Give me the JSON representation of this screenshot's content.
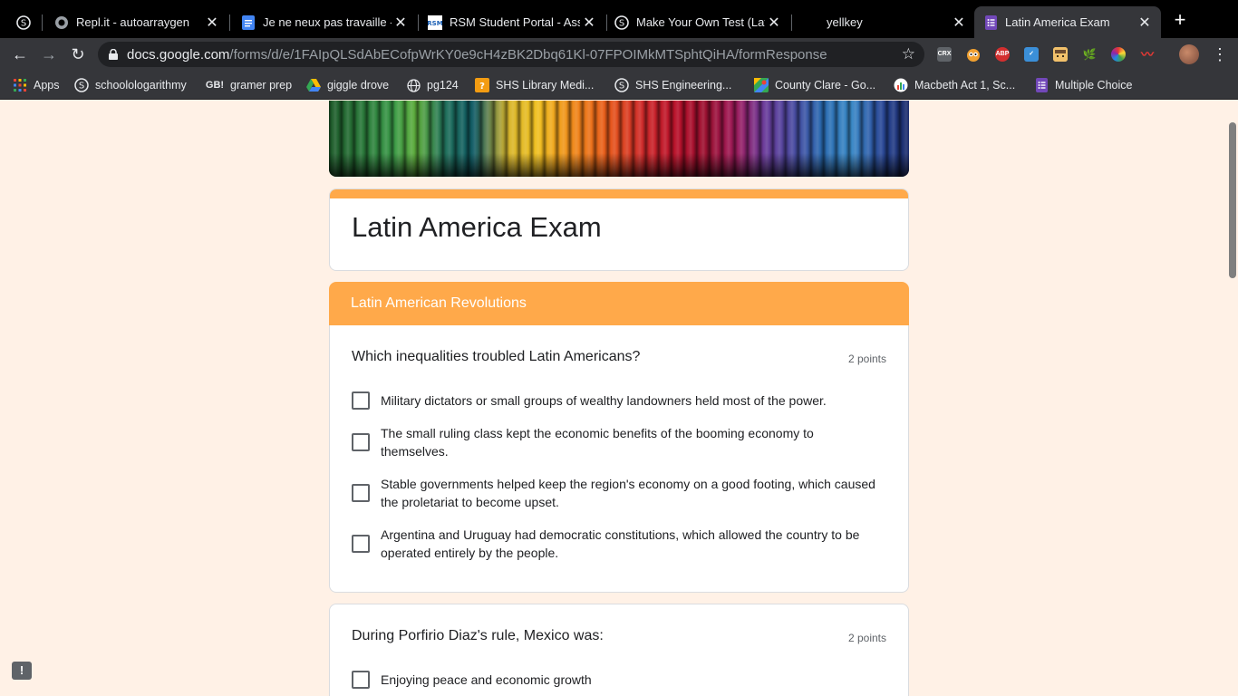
{
  "tabs": [
    {
      "label": "",
      "icon": "replit-icon"
    },
    {
      "label": "Repl.it - autoarraygen",
      "icon": "replit-icon"
    },
    {
      "label": "Je ne neux pas travaille -",
      "icon": "google-docs-icon"
    },
    {
      "label": "RSM Student Portal - Ass",
      "icon": "rsm-icon"
    },
    {
      "label": "Make Your Own Test (Lat",
      "icon": "replit-icon"
    },
    {
      "label": "yellkey",
      "icon": ""
    },
    {
      "label": "Latin America Exam",
      "icon": "google-forms-icon"
    }
  ],
  "address_bar": {
    "domain": "docs.google.com",
    "path": "/forms/d/e/1FAIpQLSdAbECofpWrKY0e9cH4zBK2Dbq61Kl-07FPOIMkMTSphtQiHA/formResponse"
  },
  "extensions": [
    "CRX",
    "ABP"
  ],
  "bookmarks": [
    {
      "label": "Apps",
      "icon": "apps-grid-icon"
    },
    {
      "label": "schoolologarithmy",
      "icon": "replit-icon"
    },
    {
      "label": "gramer prep",
      "icon": "gb-icon",
      "icon_text": "GB!"
    },
    {
      "label": "giggle drove",
      "icon": "google-drive-icon"
    },
    {
      "label": "pg124",
      "icon": "globe-icon"
    },
    {
      "label": "SHS Library Medi...",
      "icon": "library-icon"
    },
    {
      "label": "SHS Engineering...",
      "icon": "replit-icon"
    },
    {
      "label": "County Clare - Go...",
      "icon": "google-maps-icon"
    },
    {
      "label": "Macbeth Act 1, Sc...",
      "icon": "chart-icon"
    },
    {
      "label": "Multiple Choice",
      "icon": "google-forms-icon"
    }
  ],
  "form": {
    "title": "Latin America Exam",
    "section_title": "Latin American Revolutions",
    "questions": [
      {
        "text": "Which inequalities troubled Latin Americans?",
        "points": "2 points",
        "options": [
          "Military dictators or small groups of wealthy landowners held most of the power.",
          "The small ruling class kept the economic benefits of the booming economy to themselves.",
          "Stable governments helped keep the region's economy on a good footing, which caused the proletariat to become upset.",
          "Argentina and Uruguay had democratic constitutions, which allowed the country to be operated entirely by the people."
        ]
      },
      {
        "text": "During Porfirio Diaz's rule, Mexico was:",
        "points": "2 points",
        "options": [
          "Enjoying peace and economic growth"
        ]
      }
    ]
  },
  "feedback_label": "!",
  "colors": {
    "accent": "#ffa94a",
    "background": "#fff1e6",
    "chrome_dark": "#35363a"
  }
}
